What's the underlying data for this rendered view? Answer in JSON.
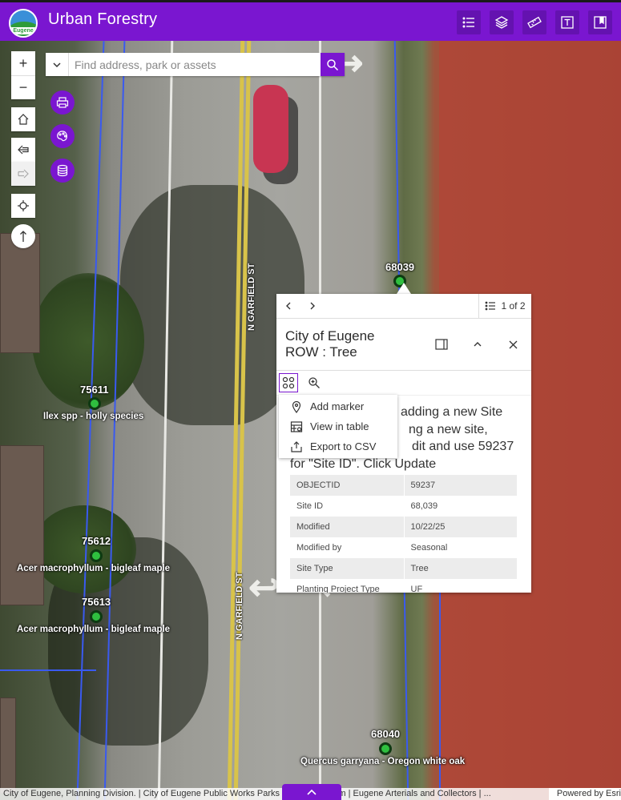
{
  "app": {
    "title": "Urban Forestry",
    "logo_text": "Eugene",
    "accent_color": "#7a16d0"
  },
  "header_buttons": [
    {
      "name": "legend-list-icon"
    },
    {
      "name": "layers-icon"
    },
    {
      "name": "measure-icon"
    },
    {
      "name": "text-icon"
    },
    {
      "name": "bookmark-icon"
    }
  ],
  "search": {
    "placeholder": "Find address, park or assets"
  },
  "map": {
    "street_labels": [
      "N GARFIELD ST",
      "N GARFIELD ST"
    ],
    "points": [
      {
        "id": "68039",
        "species": ""
      },
      {
        "id": "75611",
        "species": "Ilex spp - holly species"
      },
      {
        "id": "75612",
        "species": "Acer macrophyllum - bigleaf maple"
      },
      {
        "id": "75613",
        "species": "Acer macrophyllum - bigleaf maple"
      },
      {
        "id": "68040",
        "species": "Quercus garryana - Oregon white oak"
      }
    ]
  },
  "popup": {
    "page_count": "1 of 2",
    "title_line1": "City of Eugene",
    "title_line2": "ROW : Tree",
    "description_lines": [
      "adding a new Site",
      "ng a new site,",
      "dit and use 59237",
      "for \"Site ID\". Click Update"
    ],
    "attributes": [
      {
        "field": "OBJECTID",
        "value": "59237"
      },
      {
        "field": "Site ID",
        "value": "68,039"
      },
      {
        "field": "Modified",
        "value": "10/22/25"
      },
      {
        "field": "Modified by",
        "value": "Seasonal"
      },
      {
        "field": "Site Type",
        "value": "Tree"
      },
      {
        "field": "Planting Project Type",
        "value": "UF"
      }
    ],
    "menu": [
      {
        "label": "Add marker"
      },
      {
        "label": "View in table"
      },
      {
        "label": "Export to CSV"
      }
    ]
  },
  "attribution": {
    "text": "City of Eugene, Planning Division. | City of Eugene Public Works Parks ... ace GIS team | Eugene Arterials and Collectors | ...",
    "powered": "Powered by Esri"
  }
}
